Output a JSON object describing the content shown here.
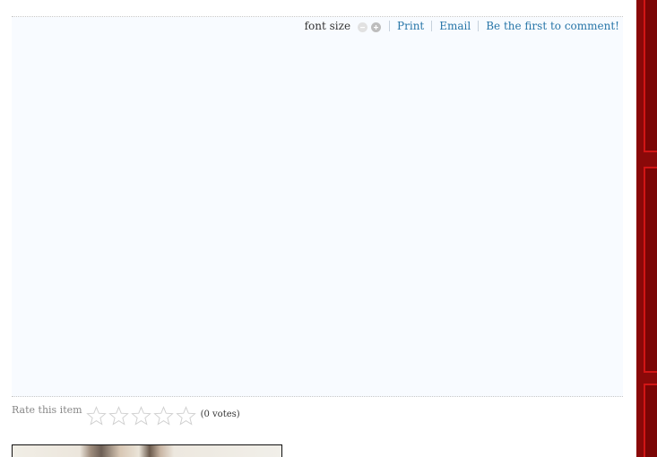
{
  "toolbar": {
    "font_size_label": "font size",
    "decrease_icon": "minus-circle-icon",
    "increase_icon": "plus-circle-icon",
    "print_label": "Print",
    "email_label": "Email",
    "comment_label": "Be the first to comment!"
  },
  "rating": {
    "label": "Rate this item",
    "stars_total": 5,
    "stars_filled": 0,
    "star_icon": "star-outline-icon",
    "votes_text": "(0 votes)"
  },
  "colors": {
    "link": "#2876a8",
    "panel_background": "#f8fbff",
    "sidebar_red": "#8a0909",
    "sidebar_border": "#d01515"
  }
}
